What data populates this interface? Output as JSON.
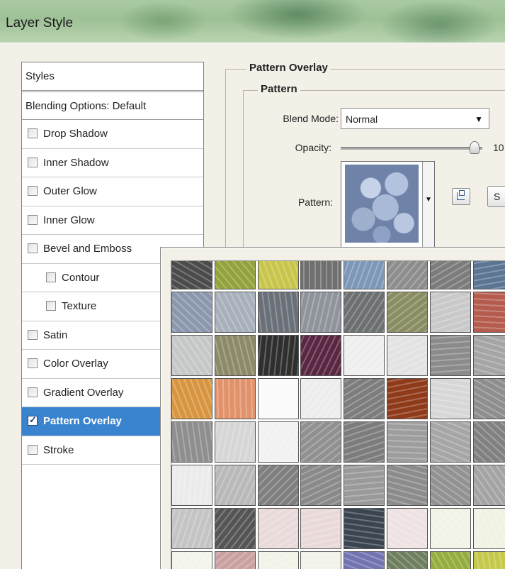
{
  "window": {
    "title": "Layer Style"
  },
  "styles_panel": {
    "header": "Styles",
    "blending_options": "Blending Options: Default",
    "items": [
      {
        "label": "Drop Shadow",
        "checked": false,
        "sub": false,
        "selected": false
      },
      {
        "label": "Inner Shadow",
        "checked": false,
        "sub": false,
        "selected": false
      },
      {
        "label": "Outer Glow",
        "checked": false,
        "sub": false,
        "selected": false
      },
      {
        "label": "Inner Glow",
        "checked": false,
        "sub": false,
        "selected": false
      },
      {
        "label": "Bevel and Emboss",
        "checked": false,
        "sub": false,
        "selected": false
      },
      {
        "label": "Contour",
        "checked": false,
        "sub": true,
        "selected": false
      },
      {
        "label": "Texture",
        "checked": false,
        "sub": true,
        "selected": false
      },
      {
        "label": "Satin",
        "checked": false,
        "sub": false,
        "selected": false
      },
      {
        "label": "Color Overlay",
        "checked": false,
        "sub": false,
        "selected": false
      },
      {
        "label": "Gradient Overlay",
        "checked": false,
        "sub": false,
        "selected": false
      },
      {
        "label": "Pattern Overlay",
        "checked": true,
        "sub": false,
        "selected": true
      },
      {
        "label": "Stroke",
        "checked": false,
        "sub": false,
        "selected": false
      }
    ]
  },
  "pattern_overlay": {
    "title": "Pattern Overlay",
    "group_title": "Pattern",
    "blend_mode_label": "Blend Mode:",
    "blend_mode_value": "Normal",
    "opacity_label": "Opacity:",
    "opacity_value": "10",
    "opacity_fraction": 0.98,
    "pattern_label": "Pattern:",
    "snap_button_label": "S"
  },
  "pattern_picker": {
    "swatch_colors": [
      [
        "#4b4b4b",
        "#93a23b",
        "#c8c64a",
        "#6f6f6f",
        "#7d97b6",
        "#8d8d8d",
        "#7c7c7c",
        "#5c7592"
      ],
      [
        "#8a97ad",
        "#a8b0bb",
        "#6a6f78",
        "#8f949c",
        "#6c7070",
        "#8a8c62",
        "#c9c9c9",
        "#b65c4f"
      ],
      [
        "#c6c8c8",
        "#8d8a68",
        "#2f2f2f",
        "#5a2743",
        "#efefef",
        "#e3e3e3",
        "#8b8b8b",
        "#a5a5a5"
      ],
      [
        "#d89540",
        "#e2926b",
        "#fafafa",
        "#ededed",
        "#7d7d7d",
        "#8f3a19",
        "#d7d7d7",
        "#8e8e8e"
      ],
      [
        "#8e8e8e",
        "#d6d6d6",
        "#f2f2f2",
        "#909090",
        "#7c7c7c",
        "#9d9d9d",
        "#a6a6a6",
        "#818181"
      ],
      [
        "#ebebeb",
        "#b9b9b9",
        "#7f7f7f",
        "#8a8a8a",
        "#9a9a9a",
        "#8c8c8c",
        "#929292",
        "#a4a4a4"
      ],
      [
        "#c4c4c4",
        "#555555",
        "#eadada",
        "#ead9d9",
        "#3a4550",
        "#efe2e2",
        "#f1f3e6",
        "#f0f2e4"
      ],
      [
        "#f3f4ea",
        "#c9a1a1",
        "#f1f3e8",
        "#f1f2e8",
        "#7274b2",
        "#6e7f60",
        "#94ad3e",
        "#c6c84a"
      ]
    ]
  }
}
